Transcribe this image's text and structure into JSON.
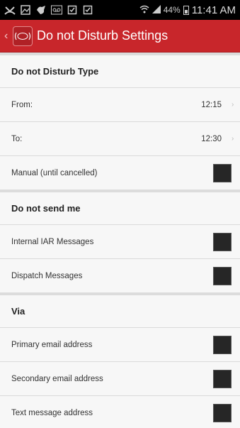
{
  "status_bar": {
    "battery": "44%",
    "time": "11:41 AM"
  },
  "action_bar": {
    "title": "Do not Disturb Settings"
  },
  "sections": [
    {
      "header": "Do not Disturb Type",
      "rows": [
        {
          "label": "From:",
          "value": "12:15"
        },
        {
          "label": "To:",
          "value": "12:30"
        },
        {
          "label": "Manual (until cancelled)",
          "checked": false
        }
      ]
    },
    {
      "header": "Do not send me",
      "rows": [
        {
          "label": "Internal IAR Messages",
          "checked": false
        },
        {
          "label": "Dispatch Messages",
          "checked": false
        }
      ]
    },
    {
      "header": "Via",
      "rows": [
        {
          "label": "Primary email address",
          "checked": false
        },
        {
          "label": "Secondary email address",
          "checked": false
        },
        {
          "label": "Text message address",
          "checked": false
        }
      ]
    }
  ],
  "colors": {
    "action_bar": "#c8262b",
    "checkbox": "#262626"
  }
}
